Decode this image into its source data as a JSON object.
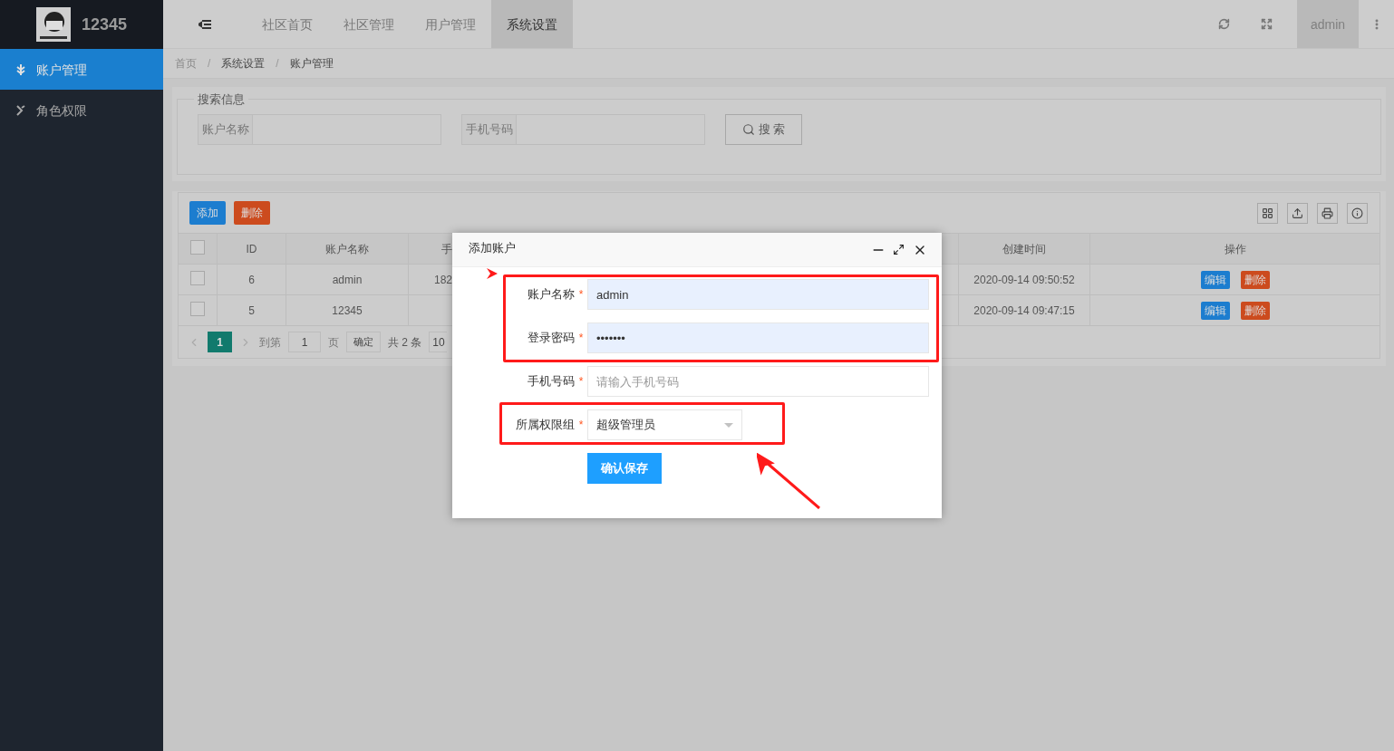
{
  "brand": {
    "title": "12345"
  },
  "sidebar": {
    "items": [
      {
        "label": "账户管理",
        "selected": true
      },
      {
        "label": "角色权限",
        "selected": false
      }
    ]
  },
  "top_nav": {
    "tabs": [
      {
        "label": "社区首页",
        "selected": false
      },
      {
        "label": "社区管理",
        "selected": false
      },
      {
        "label": "用户管理",
        "selected": false
      },
      {
        "label": "系统设置",
        "selected": true
      }
    ],
    "user": "admin"
  },
  "breadcrumb": {
    "items": [
      "首页",
      "系统设置",
      "账户管理"
    ],
    "separator": "/"
  },
  "search": {
    "legend": "搜索信息",
    "fields": [
      {
        "label": "账户名称"
      },
      {
        "label": "手机号码"
      }
    ],
    "button": "搜 索"
  },
  "toolbar": {
    "buttons": [
      {
        "label": "添加",
        "kind": "primary"
      },
      {
        "label": "删除",
        "kind": "danger"
      }
    ]
  },
  "table": {
    "header_checked": false,
    "columns": [
      "ID",
      "账户名称",
      "手",
      "创建时间",
      "操作"
    ],
    "rows": [
      {
        "checked": false,
        "cells": [
          "6",
          "admin",
          "182",
          "2020-09-14 09:50:52"
        ],
        "actions": [
          {
            "label": "编辑",
            "kind": "primary"
          },
          {
            "label": "删除",
            "kind": "danger"
          }
        ]
      },
      {
        "checked": false,
        "cells": [
          "5",
          "12345",
          "",
          "2020-09-14 09:47:15"
        ],
        "actions": [
          {
            "label": "编辑",
            "kind": "primary"
          },
          {
            "label": "删除",
            "kind": "danger"
          }
        ]
      }
    ]
  },
  "pagination": {
    "pages": [
      {
        "label": "1",
        "selected": true
      }
    ],
    "goto_label": "到第",
    "goto_value": "1",
    "page_unit": "页",
    "confirm": "确定",
    "total": "共 2 条",
    "page_size": "10"
  },
  "dialog": {
    "title": "添加账户",
    "fields": [
      {
        "kind": "text",
        "label": "账户名称",
        "required": true,
        "value": "admin"
      },
      {
        "kind": "password",
        "label": "登录密码",
        "required": true,
        "value": "•••••••"
      },
      {
        "kind": "text",
        "label": "手机号码",
        "required": true,
        "placeholder": "请输入手机号码"
      },
      {
        "kind": "select",
        "label": "所属权限组",
        "required": true,
        "value": "超级管理员"
      }
    ],
    "required_mark": "*",
    "submit": "确认保存"
  }
}
